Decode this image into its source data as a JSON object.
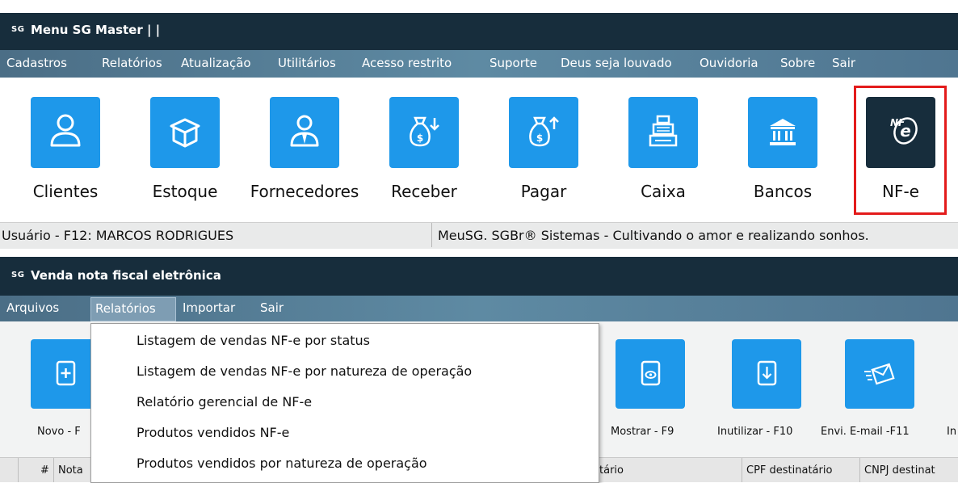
{
  "window1": {
    "logo": "SG",
    "title": "Menu SG Master | |",
    "menu": [
      "Cadastros",
      "Relatórios",
      "Atualização",
      "Utilitários",
      "Acesso restrito",
      "Suporte",
      "Deus seja louvado",
      "Ouvidoria",
      "Sobre",
      "Sair"
    ],
    "tiles": [
      {
        "label": "Clientes",
        "icon": "person-icon"
      },
      {
        "label": "Estoque",
        "icon": "box-icon"
      },
      {
        "label": "Fornecedores",
        "icon": "supplier-icon"
      },
      {
        "label": "Receber",
        "icon": "money-bag-down-icon"
      },
      {
        "label": "Pagar",
        "icon": "money-bag-up-icon"
      },
      {
        "label": "Caixa",
        "icon": "cash-register-icon"
      },
      {
        "label": "Bancos",
        "icon": "bank-icon"
      },
      {
        "label": "NF-e",
        "icon": "nfe-icon",
        "highlighted": true
      }
    ],
    "status": {
      "user": "Usuário - F12: MARCOS RODRIGUES",
      "message": "MeuSG. SGBr® Sistemas  - Cultivando o amor e realizando sonhos."
    }
  },
  "window2": {
    "logo": "SG",
    "title": "Venda nota fiscal eletrônica",
    "menu": [
      "Arquivos",
      "Relatórios",
      "Importar",
      "Sair"
    ],
    "active_menu": "Relatórios",
    "dropdown": [
      "Listagem de vendas NF-e por status",
      "Listagem de vendas NF-e por natureza de operação",
      "Relatório gerencial de NF-e",
      "Produtos vendidos NF-e",
      "Produtos vendidos por natureza de operação"
    ],
    "toolbar": [
      {
        "label": "Novo - F",
        "icon": "new-document-icon"
      },
      {
        "label": "Mostrar - F9",
        "icon": "show-document-icon"
      },
      {
        "label": "Inutilizar - F10",
        "icon": "download-document-icon"
      },
      {
        "label": "Envi. E-mail -F11",
        "icon": "send-mail-icon"
      },
      {
        "label": "In",
        "icon": ""
      }
    ],
    "grid_headers": [
      "#",
      "Nota",
      "tário",
      "CPF destinatário",
      "CNPJ destinat"
    ]
  },
  "colors": {
    "titlebar": "#172d3c",
    "menubar": "#527a94",
    "tile": "#1e98ea",
    "tile_dark": "#172d3c",
    "highlight": "#e31b1b"
  }
}
